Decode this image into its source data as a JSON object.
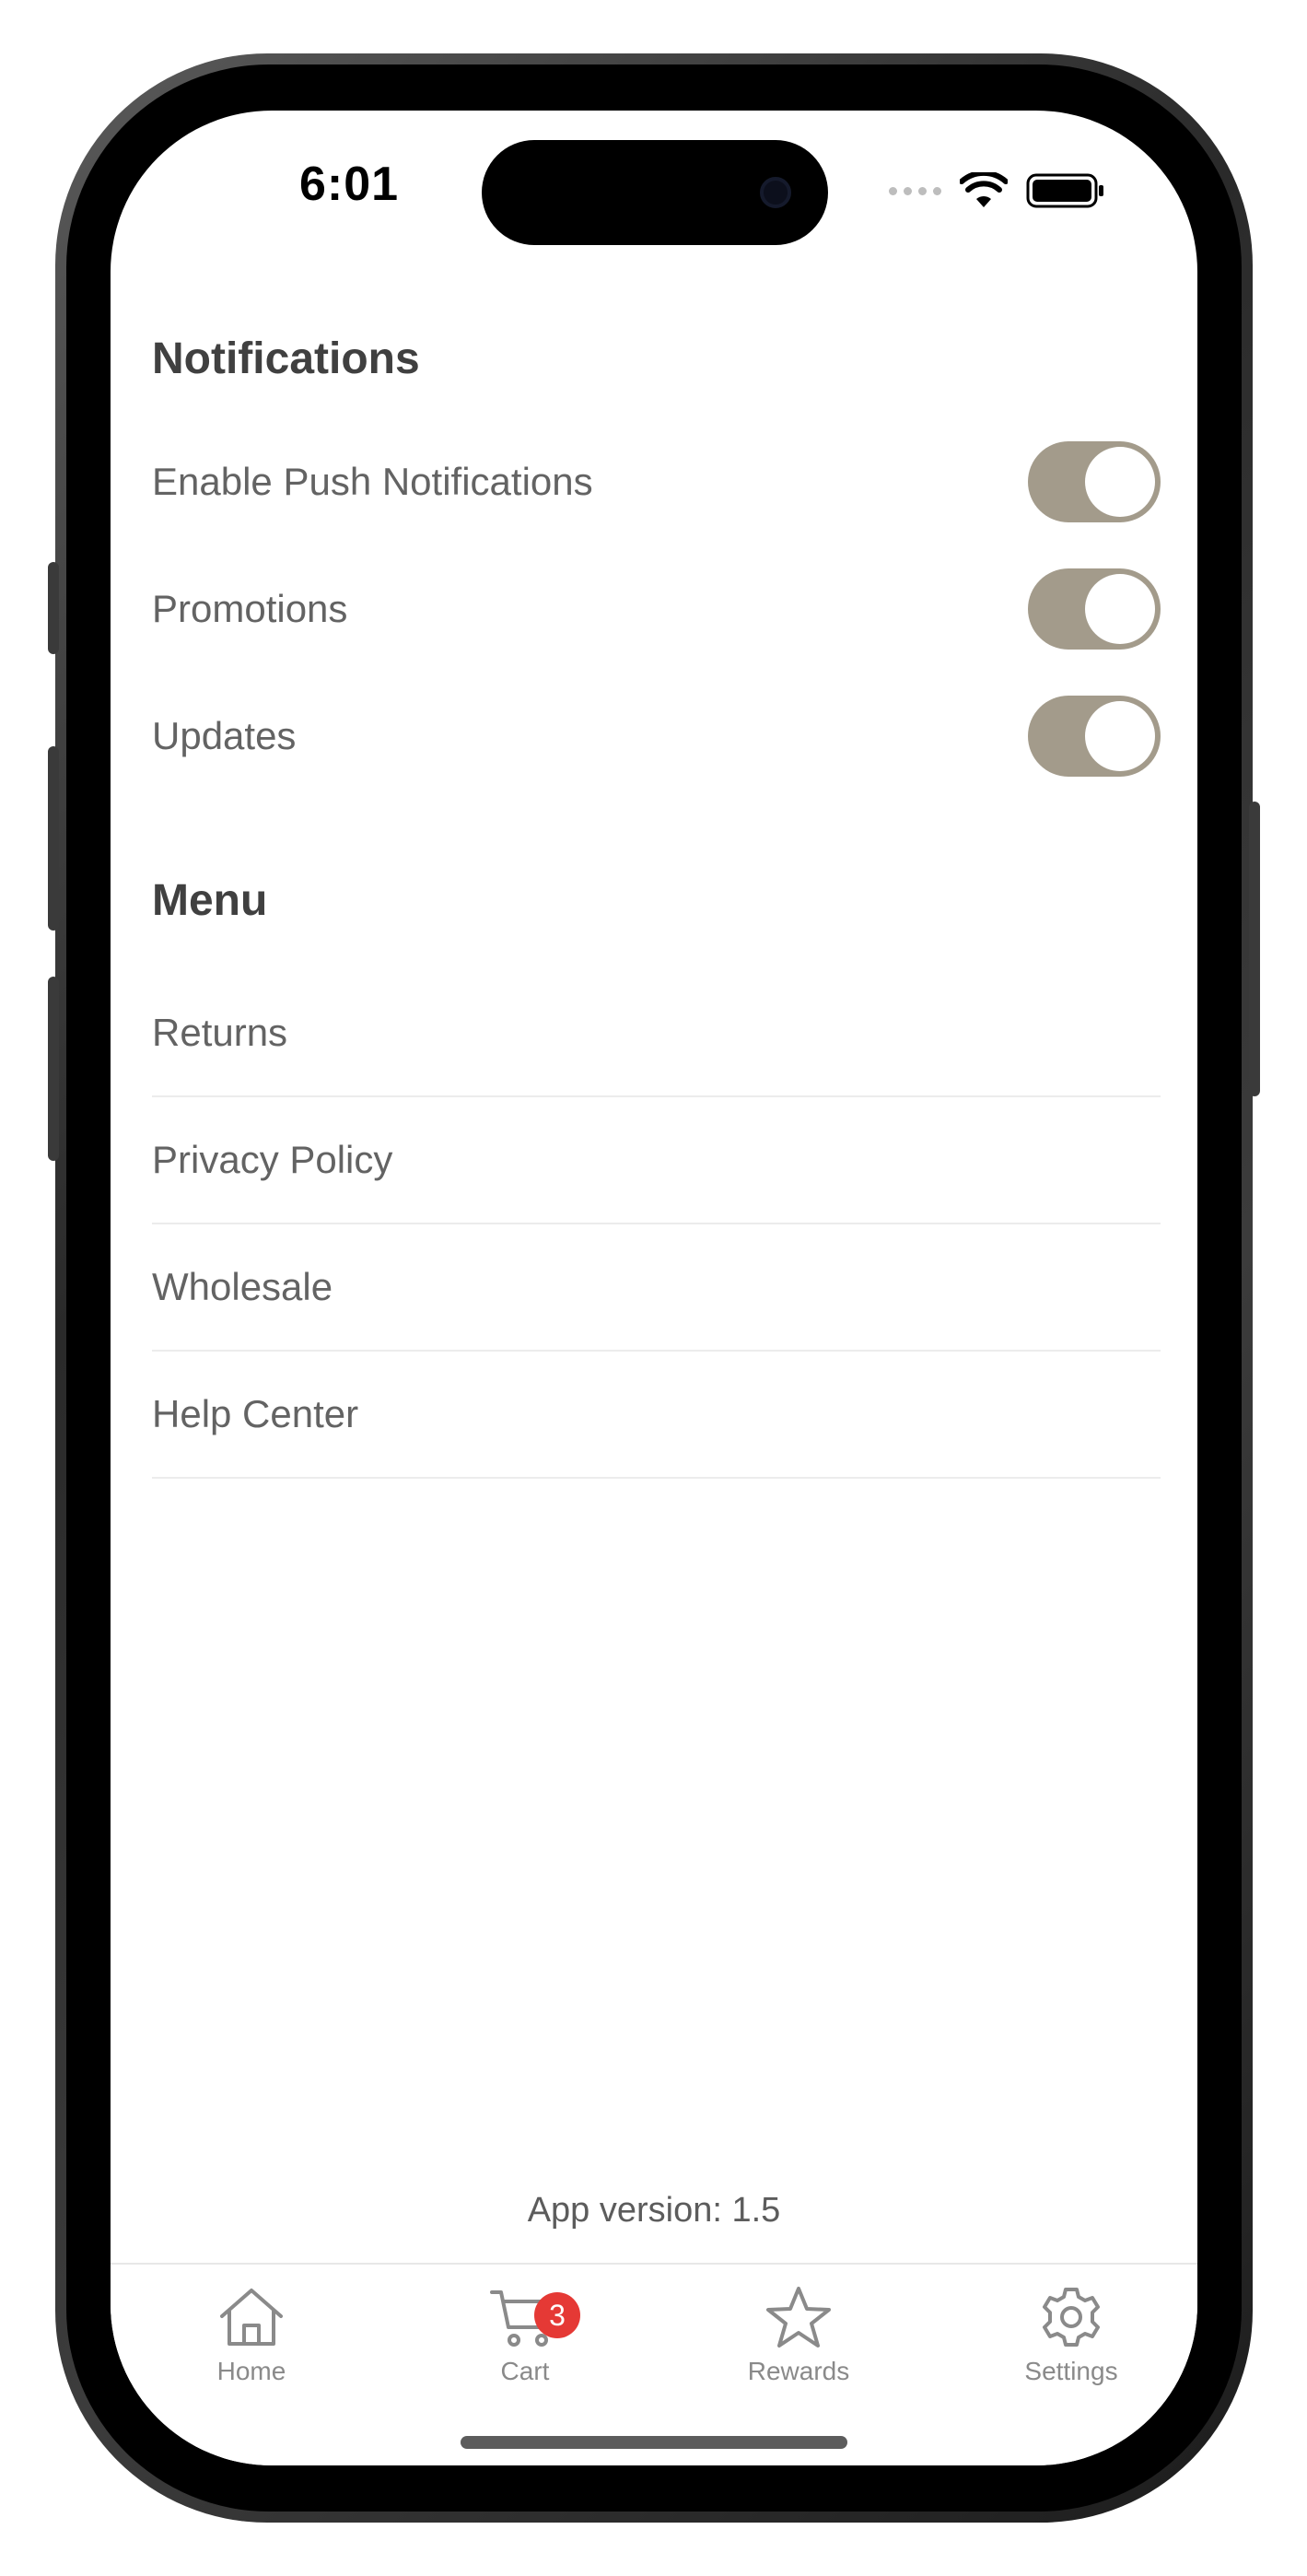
{
  "status_bar": {
    "time": "6:01"
  },
  "notifications": {
    "title": "Notifications",
    "items": [
      {
        "label": "Enable Push Notifications",
        "enabled": true
      },
      {
        "label": "Promotions",
        "enabled": true
      },
      {
        "label": "Updates",
        "enabled": true
      }
    ]
  },
  "menu": {
    "title": "Menu",
    "items": [
      {
        "label": "Returns"
      },
      {
        "label": "Privacy Policy"
      },
      {
        "label": "Wholesale"
      },
      {
        "label": "Help Center"
      }
    ]
  },
  "app_version": "App version: 1.5",
  "tabbar": {
    "items": [
      {
        "label": "Home",
        "icon": "home-icon"
      },
      {
        "label": "Cart",
        "icon": "cart-icon",
        "badge": "3"
      },
      {
        "label": "Rewards",
        "icon": "star-icon"
      },
      {
        "label": "Settings",
        "icon": "gear-icon"
      }
    ]
  },
  "colors": {
    "toggle_on": "#a39b8b",
    "badge": "#e53935",
    "text_primary": "#404040",
    "text_secondary": "#636363",
    "tab_inactive": "#8a8a8a"
  }
}
